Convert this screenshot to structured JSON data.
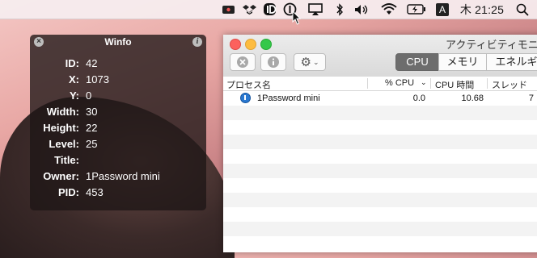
{
  "menubar": {
    "clock": "木 21:25",
    "input_indicator": "A",
    "icons": [
      "app-icon",
      "dropbox-icon",
      "1password-icon",
      "1password-mini-icon",
      "airplay-icon",
      "bluetooth-icon",
      "volume-icon",
      "wifi-icon",
      "battery-icon",
      "input-source-icon",
      "spotlight-icon"
    ]
  },
  "winfo": {
    "title": "Winfo",
    "fields": [
      {
        "key": "ID:",
        "value": "42"
      },
      {
        "key": "X:",
        "value": "1073"
      },
      {
        "key": "Y:",
        "value": "0"
      },
      {
        "key": "Width:",
        "value": "30"
      },
      {
        "key": "Height:",
        "value": "22"
      },
      {
        "key": "Level:",
        "value": "25"
      },
      {
        "key": "Title:",
        "value": ""
      },
      {
        "key": "Owner:",
        "value": "1Password mini"
      },
      {
        "key": "PID:",
        "value": "453"
      }
    ]
  },
  "activity_monitor": {
    "title": "アクティビティモニ",
    "tabs": [
      "CPU",
      "メモリ",
      "エネルギ"
    ],
    "columns": [
      "プロセス名",
      "% CPU",
      "CPU 時間",
      "スレッド"
    ],
    "rows": [
      {
        "name": "1Password mini",
        "cpu": "0.0",
        "cpu_time": "10.68",
        "threads": "7"
      }
    ]
  },
  "colors": {
    "accent_tab": "#6d6d6d",
    "close": "#fc615d",
    "minimize": "#fdbc40",
    "zoom": "#34c84a"
  }
}
